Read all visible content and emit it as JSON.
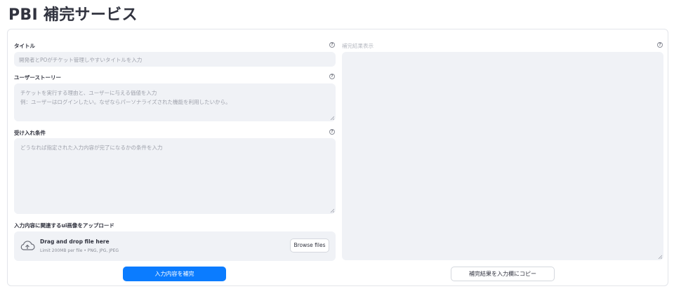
{
  "app": {
    "title": "PBI 補完サービス"
  },
  "form": {
    "title_label": "タイトル",
    "title_placeholder": "開発者とPOがチケット管理しやすいタイトルを入力",
    "story_label": "ユーザーストーリー",
    "story_placeholder_line1": "チケットを実行する理由と、ユーザーに与える価値を入力",
    "story_placeholder_line2": "例：ユーザーはログインしたい。なぜならパーソナライズされた機能を利用したいから。",
    "acceptance_label": "受け入れ条件",
    "acceptance_placeholder": "どうなれば指定された入力内容が完了になるかの条件を入力",
    "upload_label": "入力内容に関連するui画像をアップロード",
    "upload_drop_title": "Drag and drop file here",
    "upload_limit": "Limit 200MB per file • PNG, JPG, JPEG",
    "browse_label": "Browse files",
    "submit_label": "入力内容を補完"
  },
  "result": {
    "label": "補完結果表示",
    "copy_label": "補完結果を入力欄にコピー"
  },
  "icons": {
    "help": "question-circle-icon",
    "upload": "cloud-upload-icon",
    "resize": "resize-grip-icon"
  },
  "colors": {
    "primary": "#0b7cff",
    "input_bg": "#f0f2f6",
    "text": "#31333f",
    "placeholder": "#9ea1ab"
  }
}
